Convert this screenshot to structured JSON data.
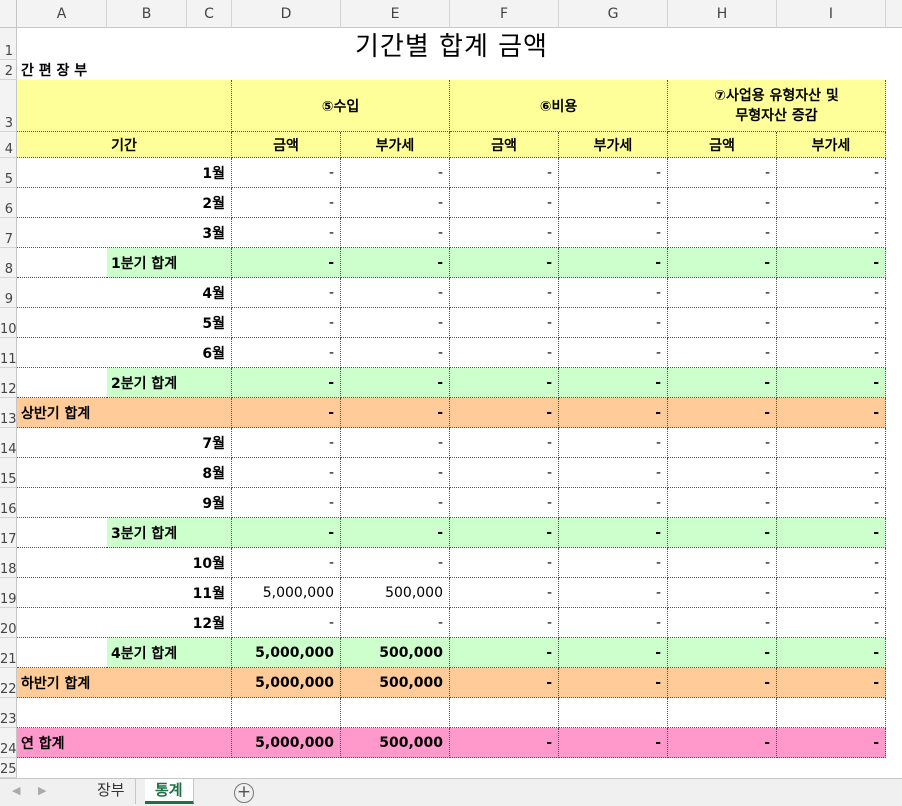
{
  "columns": [
    "A",
    "B",
    "C",
    "D",
    "E",
    "F",
    "G",
    "H",
    "I"
  ],
  "row_numbers": [
    "1",
    "2",
    "3",
    "4",
    "5",
    "6",
    "7",
    "8",
    "9",
    "10",
    "11",
    "12",
    "13",
    "14",
    "15",
    "16",
    "17",
    "18",
    "19",
    "20",
    "21",
    "22",
    "23",
    "24",
    "25"
  ],
  "title": "기간별 합계 금액",
  "subtitle": "간 편 장 부",
  "header": {
    "income": "⑤수입",
    "expense": "⑥비용",
    "assets_line1": "⑦사업용 유형자산 및",
    "assets_line2": "무형자산 증감",
    "period": "기간",
    "amount": "금액",
    "vat": "부가세"
  },
  "rows": [
    {
      "label": "1월",
      "type": "month",
      "values": [
        "-",
        "-",
        "-",
        "-",
        "-",
        "-"
      ]
    },
    {
      "label": "2월",
      "type": "month",
      "values": [
        "-",
        "-",
        "-",
        "-",
        "-",
        "-"
      ]
    },
    {
      "label": "3월",
      "type": "month",
      "values": [
        "-",
        "-",
        "-",
        "-",
        "-",
        "-"
      ]
    },
    {
      "label": "1분기 합계",
      "type": "quarter",
      "values": [
        "-",
        "-",
        "-",
        "-",
        "-",
        "-"
      ]
    },
    {
      "label": "4월",
      "type": "month",
      "values": [
        "-",
        "-",
        "-",
        "-",
        "-",
        "-"
      ]
    },
    {
      "label": "5월",
      "type": "month",
      "values": [
        "-",
        "-",
        "-",
        "-",
        "-",
        "-"
      ]
    },
    {
      "label": "6월",
      "type": "month",
      "values": [
        "-",
        "-",
        "-",
        "-",
        "-",
        "-"
      ]
    },
    {
      "label": "2분기 합계",
      "type": "quarter",
      "values": [
        "-",
        "-",
        "-",
        "-",
        "-",
        "-"
      ]
    },
    {
      "label": "상반기 합계",
      "type": "half",
      "values": [
        "-",
        "-",
        "-",
        "-",
        "-",
        "-"
      ]
    },
    {
      "label": "7월",
      "type": "month",
      "values": [
        "-",
        "-",
        "-",
        "-",
        "-",
        "-"
      ]
    },
    {
      "label": "8월",
      "type": "month",
      "values": [
        "-",
        "-",
        "-",
        "-",
        "-",
        "-"
      ]
    },
    {
      "label": "9월",
      "type": "month",
      "values": [
        "-",
        "-",
        "-",
        "-",
        "-",
        "-"
      ]
    },
    {
      "label": "3분기 합계",
      "type": "quarter",
      "values": [
        "-",
        "-",
        "-",
        "-",
        "-",
        "-"
      ]
    },
    {
      "label": "10월",
      "type": "month",
      "values": [
        "-",
        "-",
        "-",
        "-",
        "-",
        "-"
      ]
    },
    {
      "label": "11월",
      "type": "month",
      "values": [
        "5,000,000",
        "500,000",
        "-",
        "-",
        "-",
        "-"
      ]
    },
    {
      "label": "12월",
      "type": "month",
      "values": [
        "-",
        "-",
        "-",
        "-",
        "-",
        "-"
      ]
    },
    {
      "label": "4분기 합계",
      "type": "quarter",
      "values": [
        "5,000,000",
        "500,000",
        "-",
        "-",
        "-",
        "-"
      ]
    },
    {
      "label": "하반기 합계",
      "type": "half",
      "values": [
        "5,000,000",
        "500,000",
        "-",
        "-",
        "-",
        "-"
      ]
    },
    {
      "label": "",
      "type": "blank",
      "values": [
        "",
        "",
        "",
        "",
        "",
        ""
      ]
    },
    {
      "label": "연 합계",
      "type": "year",
      "values": [
        "5,000,000",
        "500,000",
        "-",
        "-",
        "-",
        "-"
      ]
    }
  ],
  "sheet_tabs": [
    "장부",
    "통계"
  ],
  "active_tab": "통계",
  "colors": {
    "header_yellow": "#ffff99",
    "quarter_green": "#ccffcc",
    "half_orange": "#ffcc99",
    "year_pink": "#ff99cc",
    "active_tab_green": "#1e7145"
  }
}
